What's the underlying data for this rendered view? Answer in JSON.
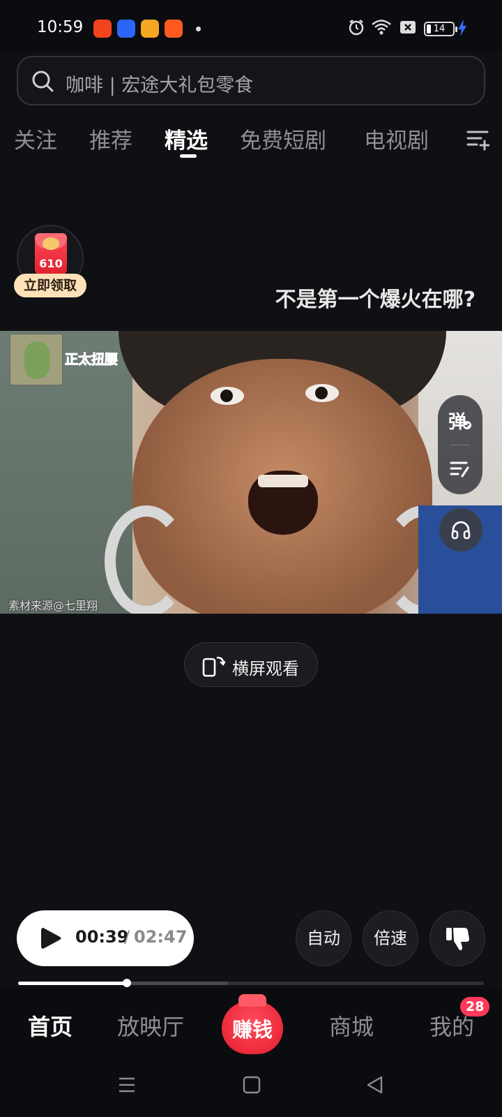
{
  "status_bar": {
    "time": "10:59",
    "battery": "14",
    "apps": [
      {
        "icon": "taobao-app-icon",
        "color": "#f2441d"
      },
      {
        "icon": "baidu-app-icon",
        "color": "#2b66f6"
      },
      {
        "icon": "video-app-icon",
        "color": "#f5a623"
      },
      {
        "icon": "kuaishou-app-icon",
        "color": "#ff5a1f"
      }
    ]
  },
  "search": {
    "placeholder": "咖啡 | 宏途大礼包零食"
  },
  "tabs": [
    {
      "label": "关注",
      "active": false
    },
    {
      "label": "推荐",
      "active": false
    },
    {
      "label": "精选",
      "active": true
    },
    {
      "label": "免费短剧",
      "active": false
    },
    {
      "label": "电视剧",
      "active": false
    }
  ],
  "red_packet": {
    "amount": "610",
    "label": "立即领取"
  },
  "video": {
    "title": "不是第一个爆火在哪?",
    "overlay_text": "正太扭腰",
    "source_text": "素材来源@七里翔"
  },
  "side_buttons": {
    "danmaku_label": "弹"
  },
  "landscape_button": {
    "label": "横屏观看"
  },
  "player": {
    "current_time": "00:39",
    "separator": "/",
    "total_time": "02:47",
    "progress_fraction": 0.234,
    "buffered_fraction": 0.45,
    "auto_label": "自动",
    "speed_label": "倍速"
  },
  "bottom_nav": {
    "items": [
      {
        "label": "首页",
        "active": true
      },
      {
        "label": "放映厅",
        "active": false
      },
      {
        "label": "赚钱",
        "active": false
      },
      {
        "label": "商城",
        "active": false
      },
      {
        "label": "我的",
        "active": false
      }
    ],
    "badge": "28"
  },
  "colors": {
    "background": "#0f1013",
    "accent_red": "#e31b2c",
    "badge_red": "#fe3a5a"
  }
}
